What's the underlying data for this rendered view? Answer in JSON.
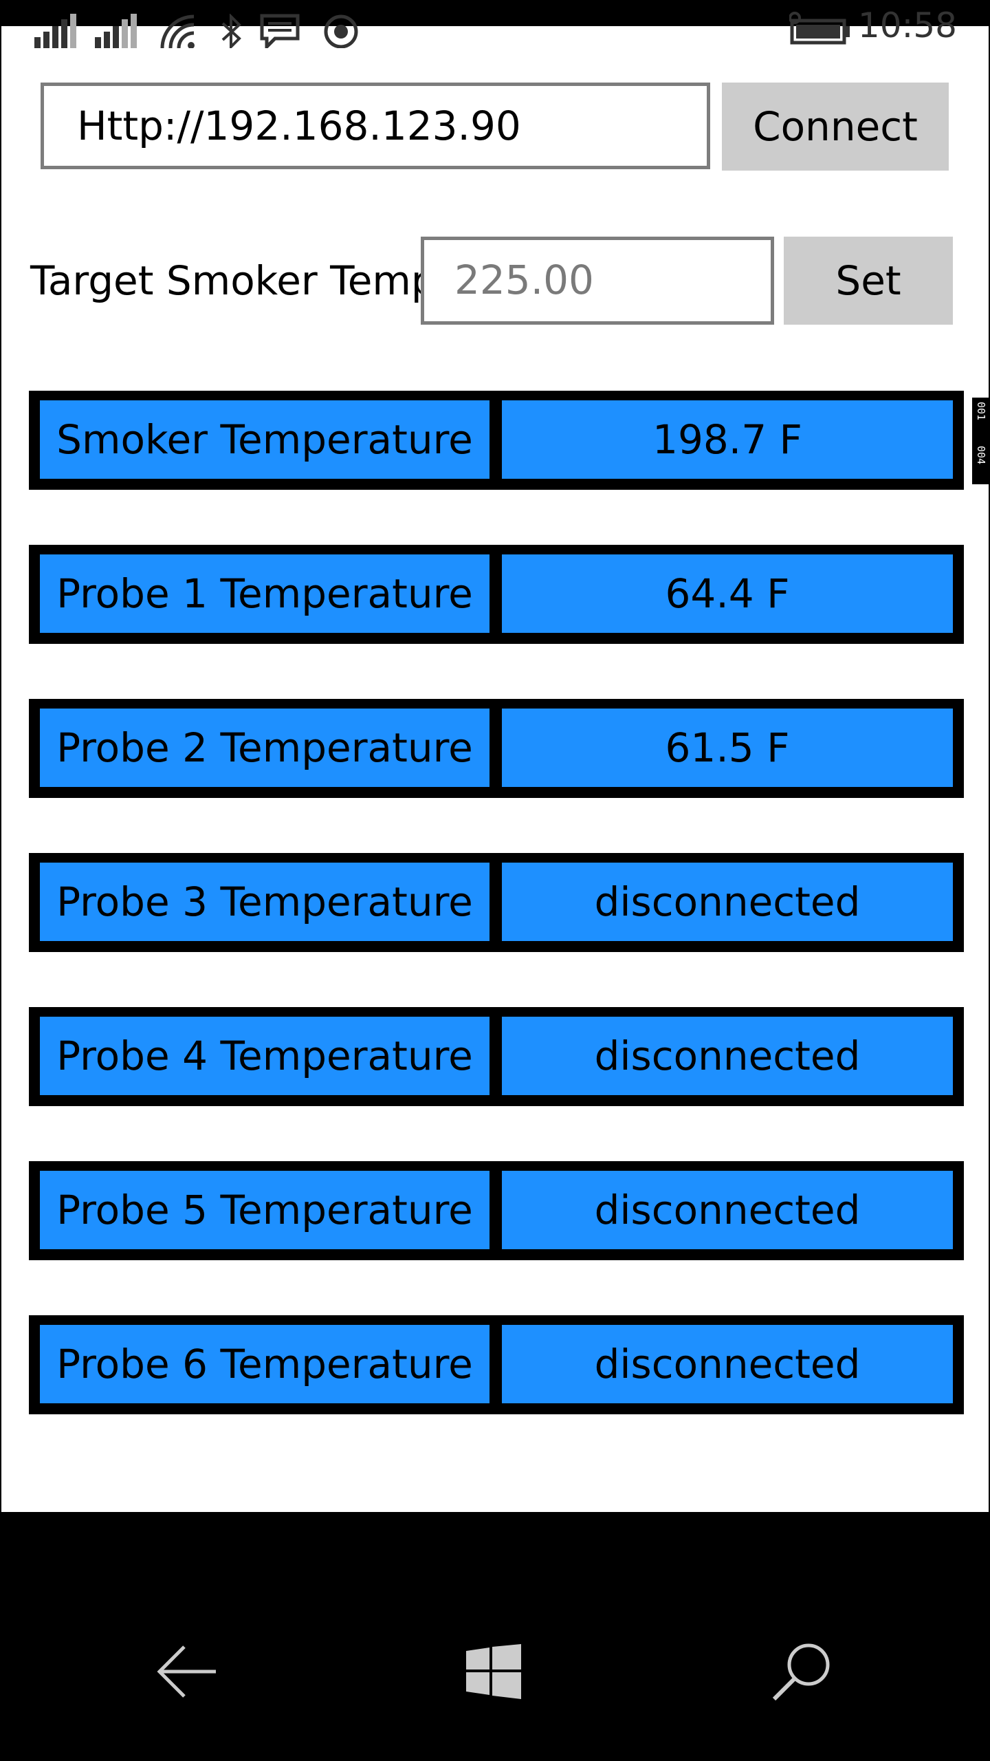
{
  "status_bar": {
    "time": "10:58",
    "icons": [
      "signal-icon",
      "signal-2-icon",
      "wifi-icon",
      "bluetooth-icon",
      "message-icon",
      "location-icon",
      "battery-icon"
    ]
  },
  "connection": {
    "url_value": "Http://192.168.123.90",
    "connect_label": "Connect"
  },
  "target": {
    "label": "Target Smoker Temp:",
    "placeholder": "225.00",
    "set_label": "Set"
  },
  "temperatures": [
    {
      "name": "Smoker Temperature",
      "value": "198.7 F"
    },
    {
      "name": "Probe 1 Temperature",
      "value": "64.4 F"
    },
    {
      "name": "Probe 2 Temperature",
      "value": "61.5 F"
    },
    {
      "name": "Probe 3 Temperature",
      "value": "disconnected"
    },
    {
      "name": "Probe 4 Temperature",
      "value": "disconnected"
    },
    {
      "name": "Probe 5 Temperature",
      "value": "disconnected"
    },
    {
      "name": "Probe 6 Temperature",
      "value": "disconnected"
    }
  ],
  "side_tag": {
    "top": "001",
    "bottom": "004"
  },
  "nav_bar": {
    "icons": [
      "back-arrow-icon",
      "windows-logo-icon",
      "search-icon"
    ]
  },
  "colors": {
    "cell_blue": "#1e90ff",
    "button_gray": "#cccccc",
    "border_gray": "#7d7d7d"
  }
}
